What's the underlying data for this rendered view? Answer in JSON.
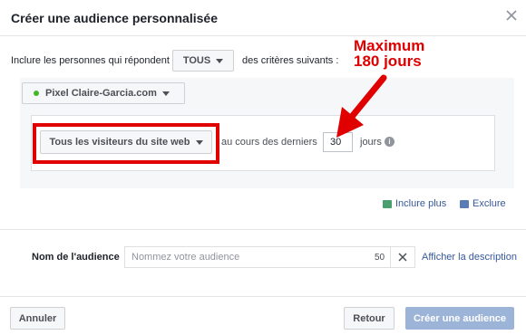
{
  "dialog": {
    "title": "Créer une audience personnalisée"
  },
  "criteria": {
    "prefix": "Inclure les personnes qui répondent",
    "match_value": "TOUS",
    "suffix": "des critères suivants :"
  },
  "pixel": {
    "name": "Pixel Claire-Garcia.com",
    "status_color": "#42b72a"
  },
  "rule": {
    "event": "Tous les visiteurs du site web",
    "during_label": "au cours des derniers",
    "days_value": "30",
    "days_label": "jours",
    "info_glyph": "i"
  },
  "annotation": {
    "line1": "Maximum",
    "line2": "180 jours",
    "color": "#e00000"
  },
  "links": {
    "include_more": "Inclure plus",
    "exclude": "Exclure"
  },
  "audience_name": {
    "label": "Nom de l'audience",
    "placeholder": "Nommez votre audience",
    "remaining_chars": "50",
    "show_description": "Afficher la description"
  },
  "footer": {
    "cancel": "Annuler",
    "back": "Retour",
    "create": "Créer une audience"
  },
  "colors": {
    "link": "#365899",
    "primary_disabled": "#9cb4d8"
  }
}
